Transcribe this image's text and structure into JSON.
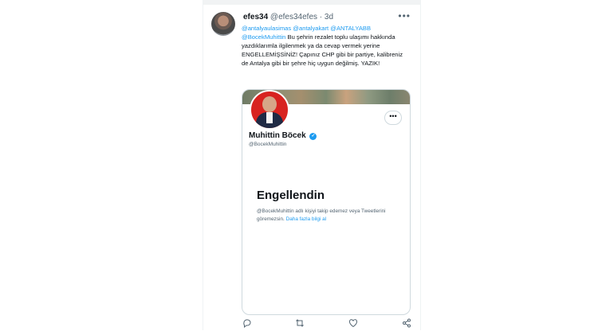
{
  "tweet": {
    "display_name": "efes34",
    "handle": "@efes34efes",
    "separator": "·",
    "time": "3d",
    "mentions": [
      "@antalyaulasimas",
      "@antalyakart",
      "@ANTALYABB",
      "@BocekMuhittin"
    ],
    "text": "Bu şehrin rezalet toplu ulaşımı hakkında yazdıklarımla ilgilenmek ya da cevap vermek yerine ENGELLEMİŞSİNİZ! Çapınız CHP gibi bir partiye, kalibreniz de Antalya gibi bir şehre hiç uygun değilmiş. YAZIK!"
  },
  "card": {
    "profile_name": "Muhittin Böcek",
    "profile_handle": "@BocekMuhittin",
    "blocked_title": "Engellendin",
    "blocked_desc": "@BocekMuhittin adlı kişiyi takip edemez veya Tweetlerini göremezsin.",
    "blocked_link": "Daha fazla bilgi al"
  },
  "icons": {
    "more": "more-icon",
    "verified": "verified-badge-icon",
    "reply": "reply-icon",
    "retweet": "retweet-icon",
    "like": "like-icon",
    "share": "share-icon"
  },
  "colors": {
    "link": "#1d9bf0",
    "secondary_text": "#536471"
  }
}
